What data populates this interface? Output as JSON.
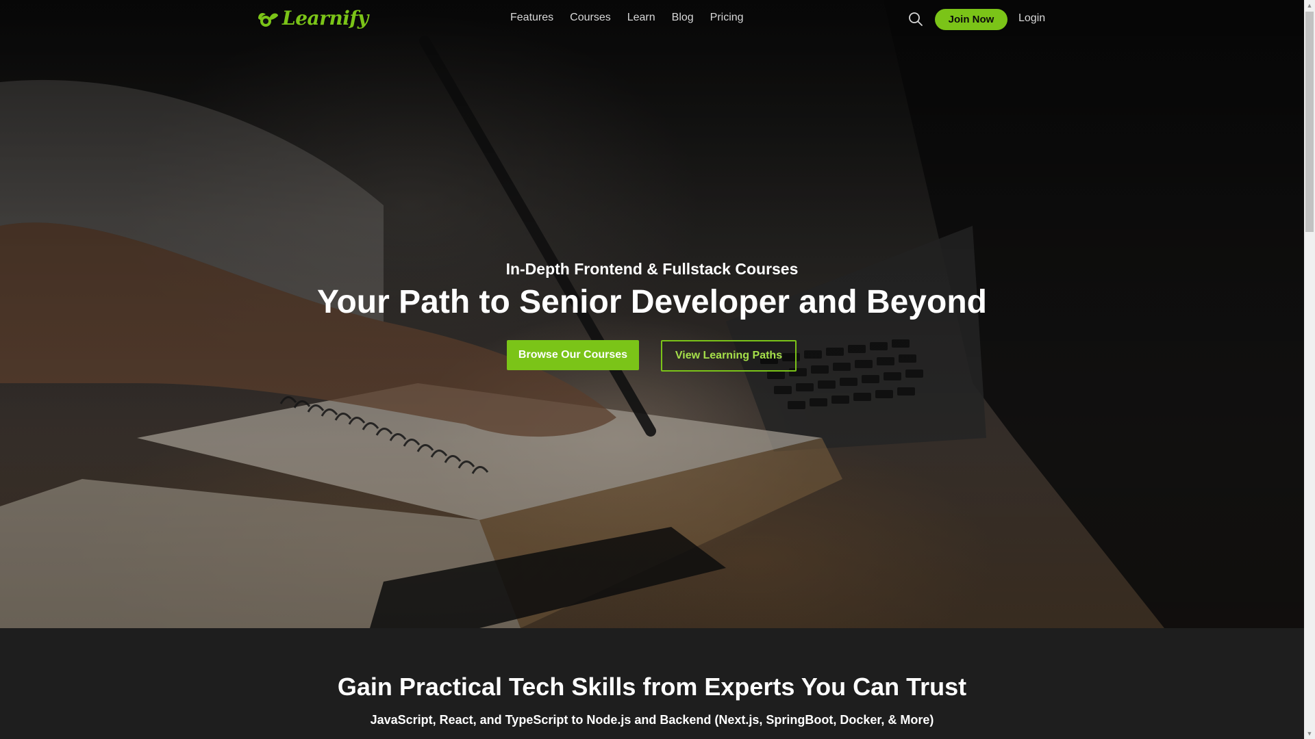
{
  "brand": {
    "name": "Learnify",
    "accent": "#7bc418"
  },
  "nav": {
    "links": [
      "Features",
      "Courses",
      "Learn",
      "Blog",
      "Pricing"
    ],
    "search_icon": "search-icon",
    "join_label": "Join Now",
    "login_label": "Login"
  },
  "hero": {
    "subtitle": "In-Depth Frontend & Fullstack Courses",
    "title": "Your Path to Senior Developer and Beyond",
    "primary_button": "Browse Our Courses",
    "secondary_button": "View Learning Paths"
  },
  "section": {
    "title": "Gain Practical Tech Skills from Experts You Can Trust",
    "subtitle": "JavaScript, React, and TypeScript to Node.js and Backend (Next.js, SpringBoot, Docker, & More)"
  }
}
